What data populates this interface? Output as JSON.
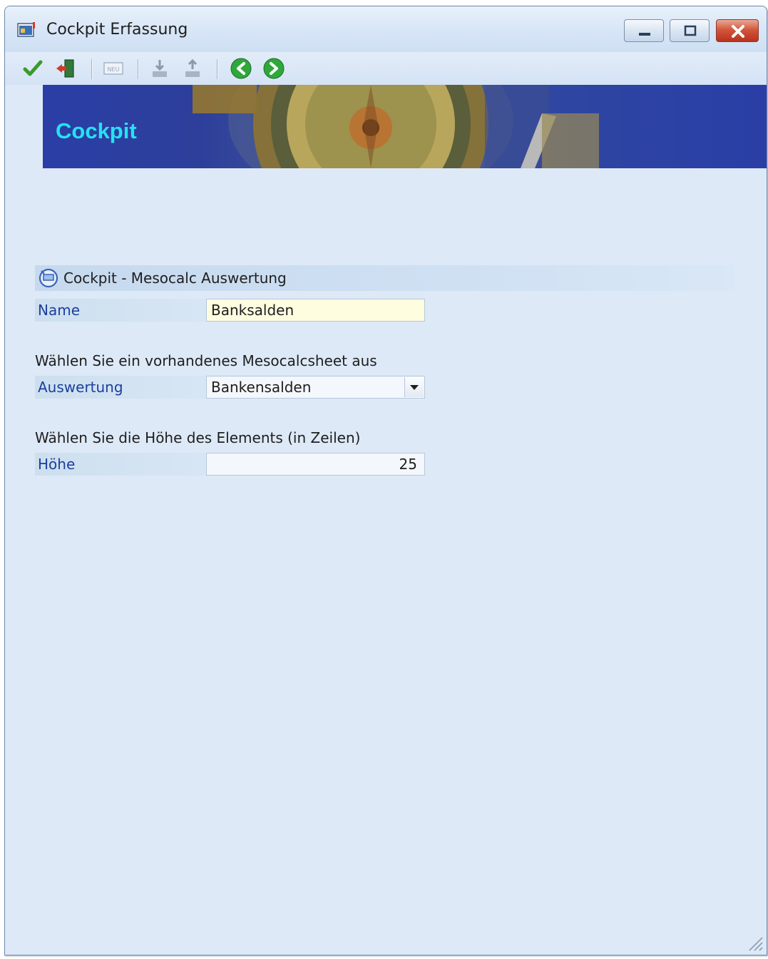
{
  "window": {
    "title": "Cockpit Erfassung"
  },
  "toolbar": {
    "items": [
      {
        "icon": "checkmark-icon",
        "label": "Speichern"
      },
      {
        "icon": "exit-door-icon",
        "label": "Beenden"
      },
      {
        "icon": "new-record-icon",
        "label": "NEU"
      },
      {
        "icon": "export-icon",
        "label": "Export"
      },
      {
        "icon": "import-icon",
        "label": "Import"
      },
      {
        "icon": "arrow-left-icon",
        "label": "Zurück"
      },
      {
        "icon": "arrow-right-icon",
        "label": "Weiter"
      }
    ]
  },
  "banner": {
    "title": "Cockpit"
  },
  "form": {
    "group_title": "Cockpit - Mesocalc Auswertung",
    "name_label": "Name",
    "name_value": "Banksalden",
    "sheet_prompt": "Wählen Sie ein vorhandenes Mesocalcsheet aus",
    "evaluation_label": "Auswertung",
    "evaluation_value": "Bankensalden",
    "height_prompt": "Wählen Sie die Höhe des Elements (in Zeilen)",
    "height_label": "Höhe",
    "height_value": "25"
  },
  "colors": {
    "label_text": "#1a3f9e",
    "banner_title": "#27e1f2",
    "banner_bg": "#2a3fa6",
    "window_bg": "#dde9f7",
    "name_field_bg": "#fffde0"
  }
}
